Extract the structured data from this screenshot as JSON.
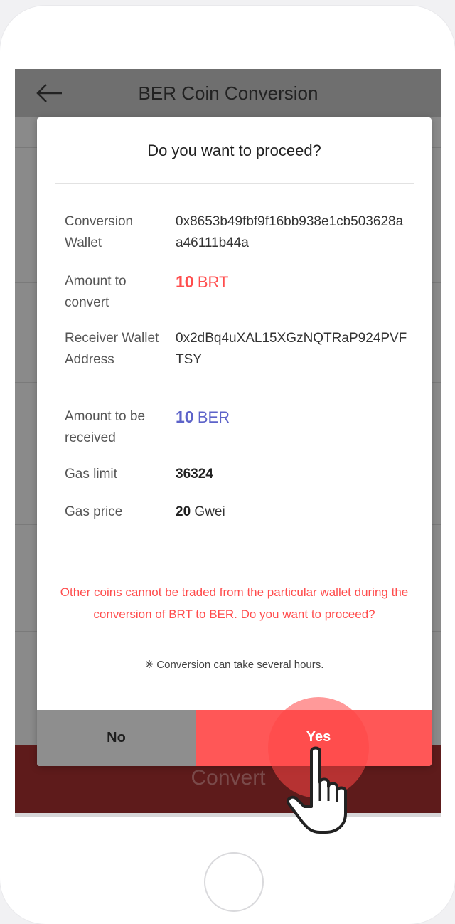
{
  "app": {
    "title": "BER Coin Conversion",
    "convert_label": "Convert"
  },
  "dialog": {
    "title": "Do you want to proceed?",
    "rows": [
      {
        "label": "Conversion Wallet",
        "value": "0x8653b49fbf9f16bb938e1cb503628aa46111b44a"
      },
      {
        "label": "Amount to convert",
        "amount": "10",
        "unit": "BRT"
      },
      {
        "label": "Receiver Wallet Address",
        "value": "0x2dBq4uXAL15XGzNQTRaP924PVFTSY"
      },
      {
        "label": "Amount to be received",
        "amount": "10",
        "unit": "BER"
      },
      {
        "label": "Gas limit",
        "value": "36324"
      },
      {
        "label": "Gas price",
        "amount": "20",
        "unit": "Gwei"
      }
    ],
    "warning": "Other coins cannot be traded from the particular wallet during the conversion of BRT to BER. Do you want to proceed?",
    "note": "※ Conversion can take several hours.",
    "no_label": "No",
    "yes_label": "Yes"
  },
  "colors": {
    "accent_red": "#ff5757",
    "text_red": "#ff4d4d",
    "text_blue": "#5d63c9",
    "neutral_button": "#8e8e8e"
  },
  "icons": {
    "back": "arrow-left-icon",
    "pointer": "hand-pointer-icon"
  }
}
